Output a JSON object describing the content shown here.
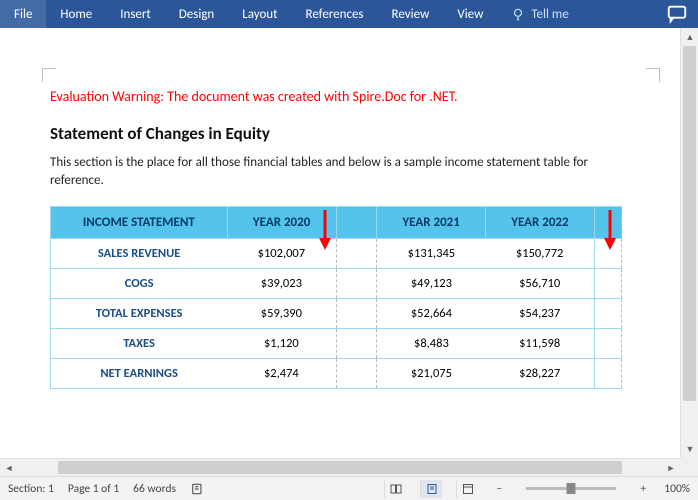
{
  "ribbon": {
    "tabs": [
      "File",
      "Home",
      "Insert",
      "Design",
      "Layout",
      "References",
      "Review",
      "View"
    ],
    "tell_me": "Tell me"
  },
  "doc": {
    "warning": "Evaluation Warning: The document was created with Spire.Doc for .NET.",
    "heading": "Statement of Changes in Equity",
    "intro": "This section is the place for all those financial tables and below is a sample income statement table for reference."
  },
  "table": {
    "headers": [
      "INCOME STATEMENT",
      "YEAR 2020",
      "",
      "YEAR 2021",
      "YEAR 2022",
      ""
    ],
    "rows": [
      [
        "SALES REVENUE",
        "$102,007",
        "",
        "$131,345",
        "$150,772",
        ""
      ],
      [
        "COGS",
        "$39,023",
        "",
        "$49,123",
        "$56,710",
        ""
      ],
      [
        "TOTAL EXPENSES",
        "$59,390",
        "",
        "$52,664",
        "$54,237",
        ""
      ],
      [
        "TAXES",
        "$1,120",
        "",
        "$8,483",
        "$11,598",
        ""
      ],
      [
        "NET EARNINGS",
        "$2,474",
        "",
        "$21,075",
        "$28,227",
        ""
      ]
    ]
  },
  "status": {
    "section": "Section: 1",
    "page": "Page 1 of 1",
    "words": "66 words",
    "zoom": "100%"
  }
}
